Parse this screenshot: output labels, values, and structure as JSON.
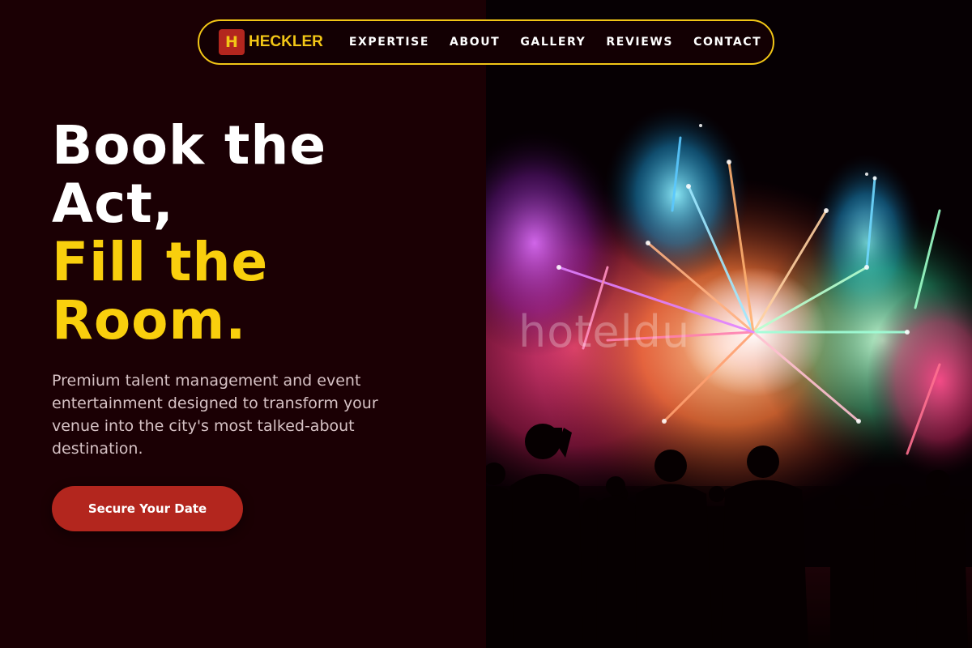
{
  "brand": {
    "mark": "H",
    "name": "HECKLER"
  },
  "nav": {
    "items": [
      {
        "label": "EXPERTISE"
      },
      {
        "label": "ABOUT"
      },
      {
        "label": "GALLERY"
      },
      {
        "label": "REVIEWS"
      },
      {
        "label": "CONTACT"
      }
    ]
  },
  "hero": {
    "headline_white": [
      "Book the",
      "Act,"
    ],
    "headline_gold": [
      "Fill the",
      "Room."
    ],
    "description": "Premium talent management and event entertainment designed to transform your venue into the city's most talked-about destination.",
    "cta_label": "Secure Your Date"
  },
  "image": {
    "subject": "fireworks-crowd-silhouette",
    "watermark": "hoteldu"
  },
  "colors": {
    "background": "#1b0004",
    "accent_gold": "#f9cf0d",
    "nav_border": "#f2c616",
    "cta_red": "#b3261e",
    "body_text": "#d6c2c5"
  }
}
